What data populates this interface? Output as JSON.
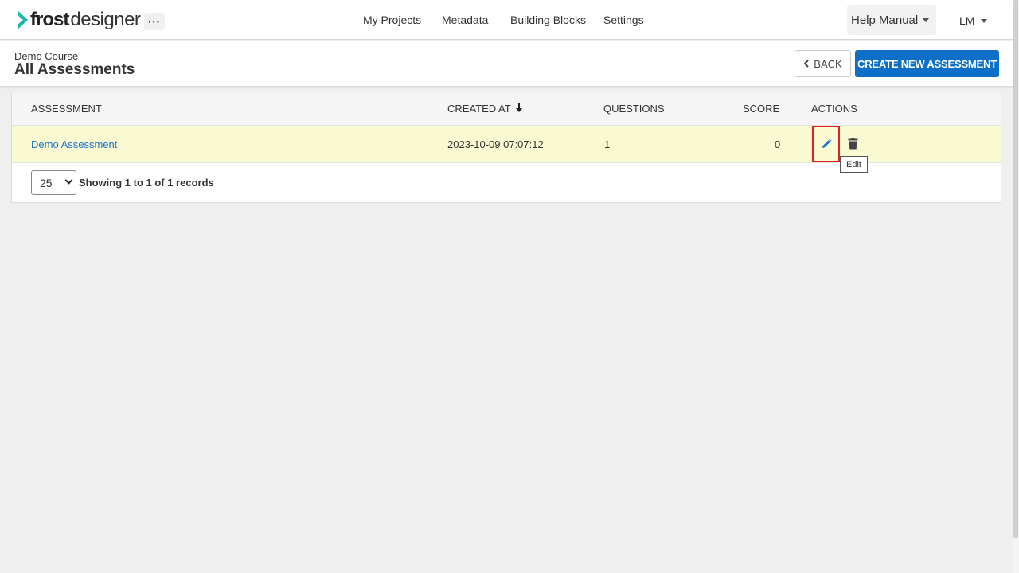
{
  "app": {
    "logo_frost": "frost",
    "logo_designer": "designer",
    "more_label": "···"
  },
  "nav": {
    "items": [
      "My Projects",
      "Metadata",
      "Building Blocks",
      "Settings"
    ]
  },
  "help": {
    "label": "Help Manual"
  },
  "user": {
    "initials": "LM"
  },
  "page": {
    "breadcrumb": "Demo Course",
    "title": "All Assessments",
    "back_label": "BACK",
    "create_label": "CREATE NEW ASSESSMENT"
  },
  "table": {
    "headers": {
      "assessment": "ASSESSMENT",
      "created_at": "CREATED AT",
      "questions": "QUESTIONS",
      "score": "SCORE",
      "actions": "ACTIONS"
    },
    "sort_arrow": "🡓",
    "rows": [
      {
        "assessment": "Demo Assessment",
        "created_at": "2023-10-09 07:07:12",
        "questions": "1",
        "score": "0"
      }
    ],
    "tooltip": "Edit"
  },
  "pagination": {
    "page_size": "25",
    "records_text": "Showing 1 to 1 of 1 records"
  },
  "colors": {
    "accent": "#0d6fc7",
    "link": "#1a73c9",
    "row_highlight": "#fafad2",
    "logo_green": "#19c37d",
    "highlight_box": "#e02020"
  },
  "icons": {
    "logo": "chevron-logo-icon",
    "edit": "pencil-icon",
    "delete": "trash-icon",
    "back": "chevron-left-icon"
  }
}
